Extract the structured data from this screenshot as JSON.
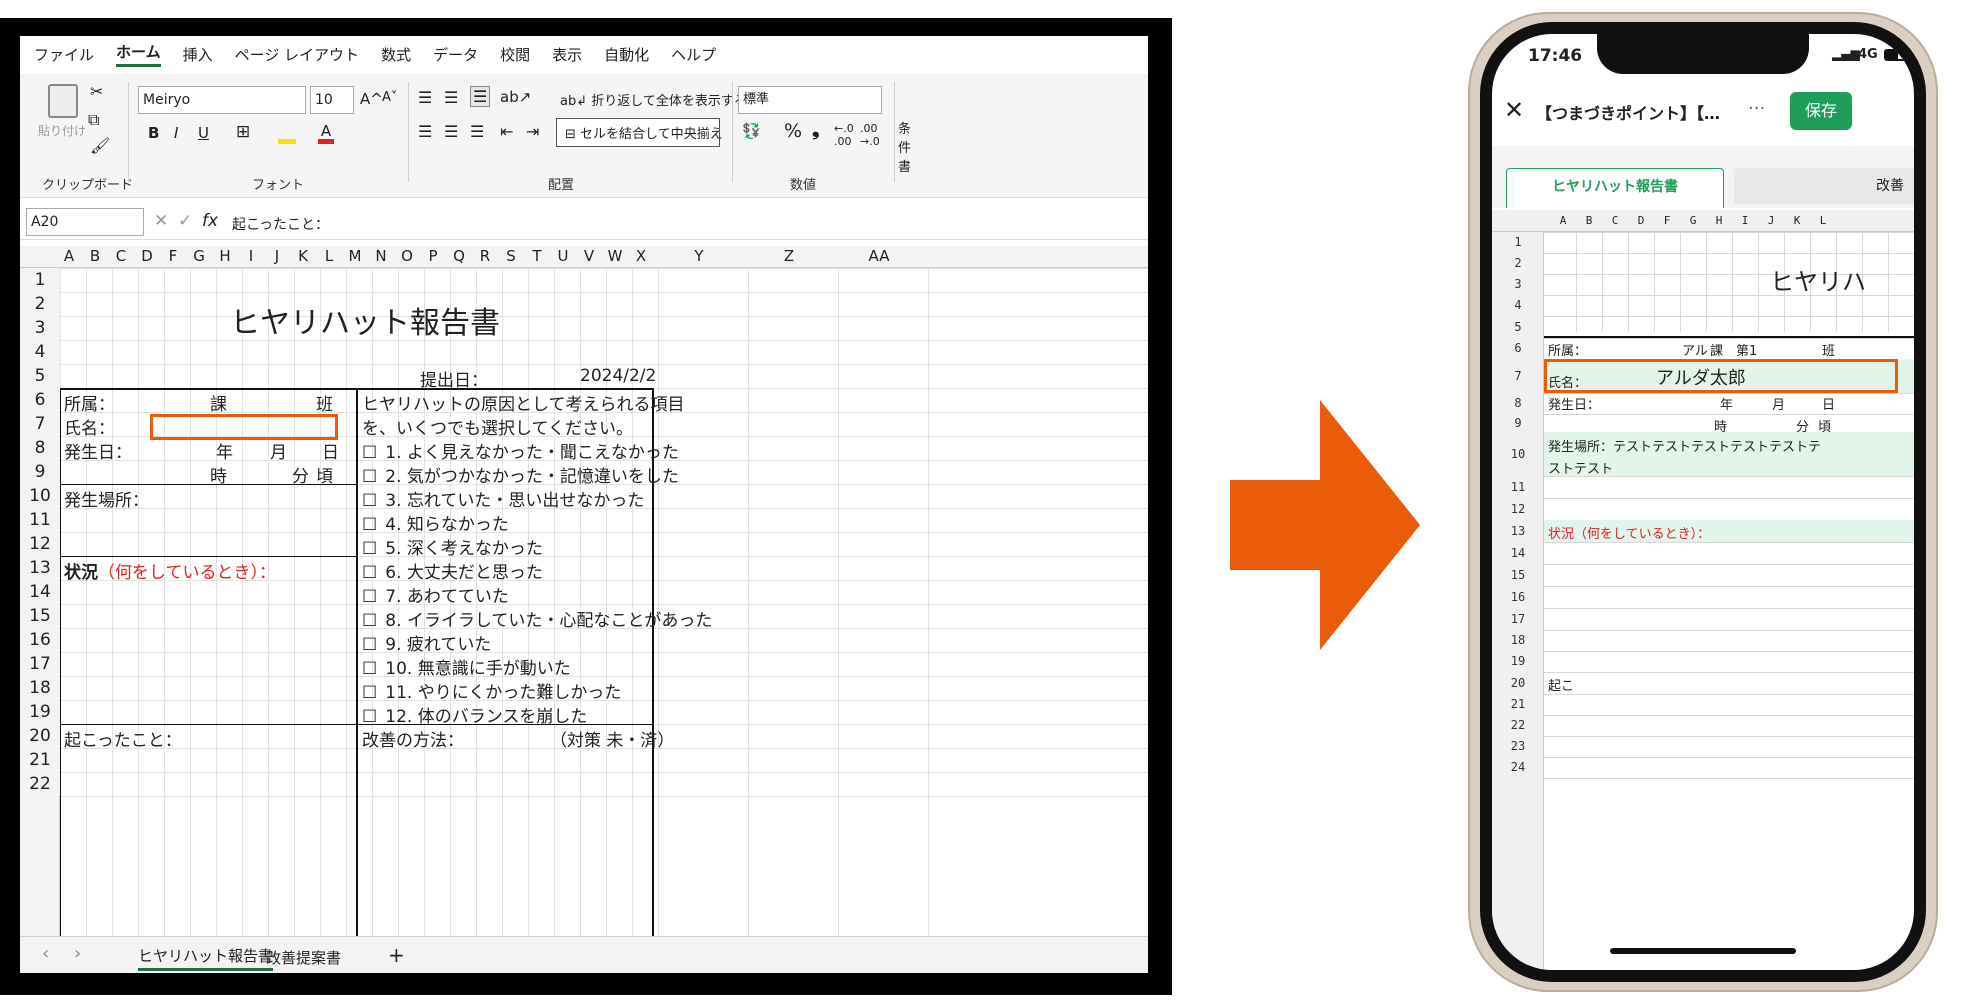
{
  "excel": {
    "menu": [
      "ファイル",
      "ホーム",
      "挿入",
      "ページ レイアウト",
      "数式",
      "データ",
      "校閲",
      "表示",
      "自動化",
      "ヘルプ"
    ],
    "ribbon": {
      "paste": "貼り付け",
      "clipboard_group": "クリップボード",
      "font_name": "Meiryo",
      "font_size": "10",
      "grow": "A^",
      "shrink": "A˅",
      "bold": "B",
      "italic": "I",
      "underline": "U",
      "font_group": "フォント",
      "wrap_text": "折り返して全体を表示する",
      "merge_center": "セルを結合して中央揃え",
      "alignment_group": "配置",
      "number_format": "標準",
      "percent": "%",
      "comma": "❟",
      "number_group": "数値",
      "conditional": "条件書"
    },
    "name_box": "A20",
    "formula": "起こったこと：",
    "columns": [
      "A",
      "B",
      "C",
      "D",
      "F",
      "G",
      "H",
      "I",
      "J",
      "K",
      "L",
      "M",
      "N",
      "O",
      "P",
      "Q",
      "R",
      "S",
      "T",
      "U",
      "V",
      "W",
      "X",
      "Y",
      "Z",
      "AA"
    ],
    "rows": [
      "1",
      "2",
      "3",
      "4",
      "5",
      "6",
      "7",
      "8",
      "9",
      "10",
      "11",
      "12",
      "13",
      "14",
      "15",
      "16",
      "17",
      "18",
      "19",
      "20",
      "21",
      "22"
    ],
    "sheet": {
      "title": "ヒヤリハット報告書",
      "submit_label": "提出日：",
      "submit_date": "2024/2/2",
      "affiliation": "所属：",
      "ka": "課",
      "han": "班",
      "name": "氏名：",
      "occurred_date": "発生日：",
      "year": "年",
      "month": "月",
      "day": "日",
      "hour": "時",
      "minute": "分",
      "koro": "頃",
      "place": "発生場所：",
      "situation_bold": "状況",
      "situation_red": "（何をしているとき）：",
      "happened": "起こったこと：",
      "cause_line1": "ヒヤリハットの原因として考えられる項目",
      "cause_line2": "を、いくつでも選択してください。",
      "checkbox": "☐",
      "causes": [
        "1. よく見えなかった・聞こえなかった",
        "2. 気がつかなかった・記憶違いをした",
        "3. 忘れていた・思い出せなかった",
        "4. 知らなかった",
        "5. 深く考えなかった",
        "6. 大丈夫だと思った",
        "7. あわてていた",
        "8. イライラしていた・心配なことがあった",
        "9. 疲れていた",
        "10. 無意識に手が動いた",
        "11. やりにくかった難しかった",
        "12. 体のバランスを崩した"
      ],
      "improve": "改善の方法：",
      "measure": "（対策 未・済）"
    },
    "tabs": [
      "ヒヤリハット報告書",
      "改善提案書"
    ],
    "add_sheet": "+",
    "nav_prev": "‹",
    "nav_next": "›"
  },
  "colors": {
    "accent": "#ea5b0c",
    "excel_green": "#1e7145",
    "app_green": "#1e9e5a",
    "red_text": "#e02020",
    "cell_green": "#e3f4ea"
  },
  "phone": {
    "time": "17:46",
    "network": "4G",
    "close": "✕",
    "doc_title": "【つまづきポイント】【…",
    "more": "···",
    "save": "保存",
    "tabs": [
      "ヒヤリハット報告書",
      "改善"
    ],
    "columns": [
      "A",
      "B",
      "C",
      "D",
      "F",
      "G",
      "H",
      "I",
      "J",
      "K",
      "L"
    ],
    "rows": [
      "1",
      "2",
      "3",
      "4",
      "5",
      "6",
      "7",
      "8",
      "9",
      "10",
      "11",
      "12",
      "13",
      "14",
      "15",
      "16",
      "17",
      "18",
      "19",
      "20",
      "21",
      "22",
      "23",
      "24"
    ],
    "sheet": {
      "title": "ヒヤリハ",
      "affiliation": "所属：",
      "affiliation_value": "アル",
      "ka": "課",
      "dai": "第1",
      "han": "班",
      "name": "氏名：",
      "name_value": "アルダ太郎",
      "occurred_date": "発生日：",
      "year": "年",
      "month": "月",
      "day": "日",
      "hour": "時",
      "minute": "分",
      "koro": "頃",
      "place_line1": "発生場所：テストテストテストテストテストテ",
      "place_line2": "ストテスト",
      "situation": "状況（何をしているとき）：",
      "happened": "起こ"
    }
  }
}
